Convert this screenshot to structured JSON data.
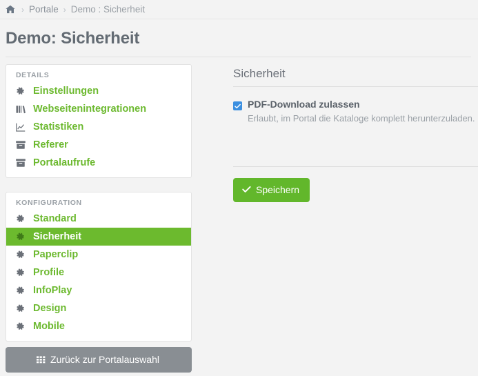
{
  "breadcrumb": {
    "home_icon": "home-icon",
    "separator": "›",
    "items": [
      {
        "label": "Portale",
        "current": false
      },
      {
        "label": "Demo : Sicherheit",
        "current": true
      }
    ]
  },
  "page": {
    "title": "Demo: Sicherheit"
  },
  "sidebar": {
    "details": {
      "heading": "DETAILS",
      "items": [
        {
          "label": "Einstellungen",
          "icon": "gear-icon",
          "active": false
        },
        {
          "label": "Webseitenintegrationen",
          "icon": "books-icon",
          "active": false
        },
        {
          "label": "Statistiken",
          "icon": "line-chart-icon",
          "active": false
        },
        {
          "label": "Referer",
          "icon": "archive-icon",
          "active": false
        },
        {
          "label": "Portalaufrufe",
          "icon": "archive-icon",
          "active": false
        }
      ]
    },
    "konfiguration": {
      "heading": "KONFIGURATION",
      "items": [
        {
          "label": "Standard",
          "icon": "gear-icon",
          "active": false
        },
        {
          "label": "Sicherheit",
          "icon": "gear-icon",
          "active": true
        },
        {
          "label": "Paperclip",
          "icon": "gear-icon",
          "active": false
        },
        {
          "label": "Profile",
          "icon": "gear-icon",
          "active": false
        },
        {
          "label": "InfoPlay",
          "icon": "gear-icon",
          "active": false
        },
        {
          "label": "Design",
          "icon": "gear-icon",
          "active": false
        },
        {
          "label": "Mobile",
          "icon": "gear-icon",
          "active": false
        }
      ]
    },
    "back_button": {
      "label": "Zurück zur Portalauswahl",
      "icon": "grid-icon"
    }
  },
  "main": {
    "title": "Sicherheit",
    "checkbox": {
      "label": "PDF-Download zulassen",
      "help": "Erlaubt, im Portal die Kataloge komplett herunterzuladen.",
      "checked": true,
      "icon": "check-icon"
    },
    "save_button": {
      "label": "Speichern",
      "icon": "check-icon"
    }
  },
  "colors": {
    "accent_green": "#6cba2e",
    "link_green": "#6cb92f",
    "save_green": "#62b72b",
    "gray_button": "#898e93",
    "checkbox_blue": "#3b8fe0",
    "page_bg": "#f3f3f3",
    "card_bg": "#ffffff",
    "heading_gray": "#9aa0a6",
    "title_gray": "#636b73"
  }
}
